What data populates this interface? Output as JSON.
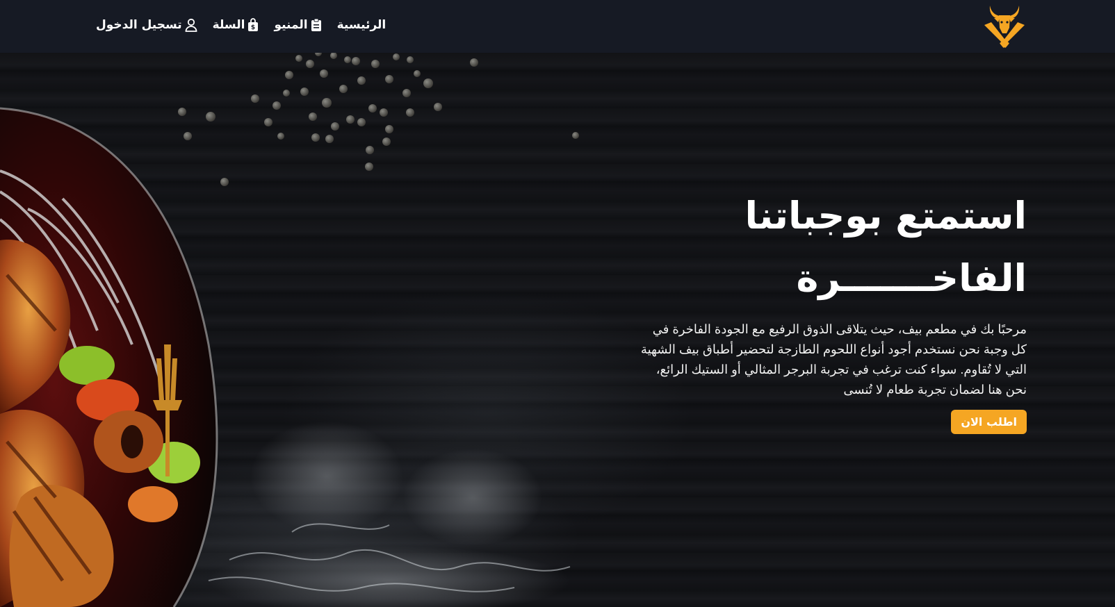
{
  "nav": {
    "links": [
      {
        "label": "الرئيسية",
        "icon": "none"
      },
      {
        "label": "المنيو",
        "icon": "clipboard-icon"
      },
      {
        "label": "السلة",
        "icon": "shopping-bag-icon"
      },
      {
        "label": "تسجيل الدخول",
        "icon": "user-icon"
      }
    ],
    "logo": "bull-knives-logo"
  },
  "hero": {
    "title_line1": "استمتع بوجباتنا",
    "title_line2": "الفاخـــــــرة",
    "description": "مرحبًا بك في مطعم بيف، حيث يتلاقى الذوق الرفيع مع الجودة الفاخرة في كل وجبة نحن نستخدم أجود أنواع اللحوم الطازجة لتحضير أطباق بيف الشهية التي لا تُقاوم. سواء كنت ترغب في تجربة البرجر المثالي أو الستيك الرائع، نحن هنا لضمان تجربة طعام لا تُنسى",
    "order_button": "اطلب الان"
  },
  "colors": {
    "navbar_bg": "#161a24",
    "accent": "#f5a623",
    "hero_bg": "#111215",
    "text": "#ffffff"
  }
}
